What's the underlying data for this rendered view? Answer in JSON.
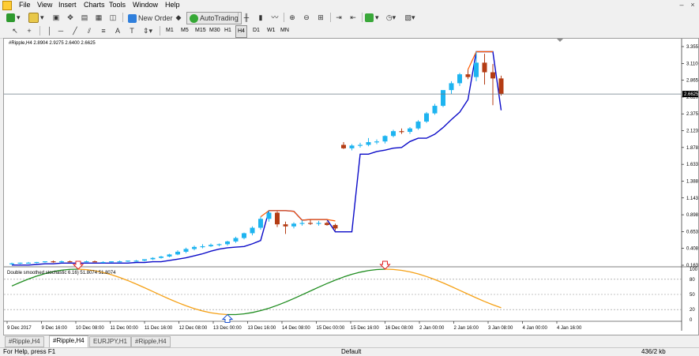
{
  "menu": {
    "items": [
      "File",
      "View",
      "Insert",
      "Charts",
      "Tools",
      "Window",
      "Help"
    ]
  },
  "toolbar": {
    "new_order": "New Order",
    "autotrading": "AutoTrading"
  },
  "timeframes": [
    "M1",
    "M5",
    "M15",
    "M30",
    "H1",
    "H4",
    "D1",
    "W1",
    "MN"
  ],
  "active_timeframe": "H4",
  "chart": {
    "symbol_label": "#Ripple,H4  2.8904 2.9275 2.6400 2.6625",
    "current_price": "2.6625",
    "price_axis": [
      "3.3550",
      "3.1100",
      "2.8650",
      "2.6200",
      "2.3750",
      "2.1230",
      "1.8780",
      "1.6330",
      "1.3880",
      "1.1430",
      "0.8980",
      "0.6530",
      "0.4080",
      "0.1630"
    ],
    "time_axis": [
      "9 Dec 2017",
      "9 Dec 16:00",
      "10 Dec 08:00",
      "11 Dec 00:00",
      "11 Dec 16:00",
      "12 Dec 08:00",
      "13 Dec 00:00",
      "13 Dec 16:00",
      "14 Dec 08:00",
      "15 Dec 00:00",
      "15 Dec 16:00",
      "16 Dec 08:00",
      "2 Jan 00:00",
      "2 Jan 16:00",
      "3 Jan 08:00",
      "4 Jan 00:00",
      "4 Jan 16:00"
    ],
    "indicator_label": "Double smoothed stochastic 6.16) 51.8074 51.8074",
    "indicator_axis": [
      "100",
      "80",
      "50",
      "20",
      "0"
    ],
    "colors": {
      "bull": "#1eb4f0",
      "bear": "#b43c14",
      "trail_up": "#0a0ac8",
      "trail_down": "#ff5a00",
      "stoch_up": "#1e8c1e",
      "stoch_down": "#f5a014",
      "arrow_down": "#e02020",
      "arrow_up": "#1a50d0"
    }
  },
  "chart_data": {
    "type": "candlestick",
    "ylim": [
      0.163,
      3.355
    ],
    "candles": [
      {
        "o": 0.18,
        "h": 0.2,
        "l": 0.17,
        "c": 0.19
      },
      {
        "o": 0.19,
        "h": 0.2,
        "l": 0.18,
        "c": 0.2
      },
      {
        "o": 0.2,
        "h": 0.21,
        "l": 0.19,
        "c": 0.2
      },
      {
        "o": 0.2,
        "h": 0.21,
        "l": 0.19,
        "c": 0.21
      },
      {
        "o": 0.21,
        "h": 0.22,
        "l": 0.2,
        "c": 0.22
      },
      {
        "o": 0.22,
        "h": 0.23,
        "l": 0.2,
        "c": 0.21
      },
      {
        "o": 0.21,
        "h": 0.23,
        "l": 0.2,
        "c": 0.22
      },
      {
        "o": 0.22,
        "h": 0.23,
        "l": 0.21,
        "c": 0.21
      },
      {
        "o": 0.21,
        "h": 0.22,
        "l": 0.2,
        "c": 0.22
      },
      {
        "o": 0.22,
        "h": 0.23,
        "l": 0.21,
        "c": 0.22
      },
      {
        "o": 0.22,
        "h": 0.23,
        "l": 0.21,
        "c": 0.21
      },
      {
        "o": 0.21,
        "h": 0.22,
        "l": 0.2,
        "c": 0.21
      },
      {
        "o": 0.21,
        "h": 0.22,
        "l": 0.2,
        "c": 0.22
      },
      {
        "o": 0.22,
        "h": 0.23,
        "l": 0.21,
        "c": 0.22
      },
      {
        "o": 0.22,
        "h": 0.23,
        "l": 0.21,
        "c": 0.23
      },
      {
        "o": 0.23,
        "h": 0.24,
        "l": 0.22,
        "c": 0.23
      },
      {
        "o": 0.23,
        "h": 0.25,
        "l": 0.22,
        "c": 0.25
      },
      {
        "o": 0.25,
        "h": 0.28,
        "l": 0.24,
        "c": 0.27
      },
      {
        "o": 0.27,
        "h": 0.3,
        "l": 0.26,
        "c": 0.29
      },
      {
        "o": 0.29,
        "h": 0.33,
        "l": 0.28,
        "c": 0.32
      },
      {
        "o": 0.32,
        "h": 0.38,
        "l": 0.31,
        "c": 0.36
      },
      {
        "o": 0.36,
        "h": 0.42,
        "l": 0.34,
        "c": 0.4
      },
      {
        "o": 0.4,
        "h": 0.45,
        "l": 0.38,
        "c": 0.43
      },
      {
        "o": 0.43,
        "h": 0.47,
        "l": 0.41,
        "c": 0.44
      },
      {
        "o": 0.44,
        "h": 0.48,
        "l": 0.43,
        "c": 0.46
      },
      {
        "o": 0.46,
        "h": 0.48,
        "l": 0.44,
        "c": 0.47
      },
      {
        "o": 0.47,
        "h": 0.52,
        "l": 0.45,
        "c": 0.51
      },
      {
        "o": 0.51,
        "h": 0.58,
        "l": 0.49,
        "c": 0.56
      },
      {
        "o": 0.56,
        "h": 0.64,
        "l": 0.54,
        "c": 0.63
      },
      {
        "o": 0.63,
        "h": 0.73,
        "l": 0.6,
        "c": 0.71
      },
      {
        "o": 0.71,
        "h": 0.87,
        "l": 0.68,
        "c": 0.84
      },
      {
        "o": 0.84,
        "h": 0.96,
        "l": 0.8,
        "c": 0.93
      },
      {
        "o": 0.93,
        "h": 0.95,
        "l": 0.72,
        "c": 0.76
      },
      {
        "o": 0.76,
        "h": 0.8,
        "l": 0.62,
        "c": 0.73
      },
      {
        "o": 0.73,
        "h": 0.79,
        "l": 0.7,
        "c": 0.77
      },
      {
        "o": 0.77,
        "h": 0.82,
        "l": 0.74,
        "c": 0.78
      },
      {
        "o": 0.78,
        "h": 0.83,
        "l": 0.75,
        "c": 0.77
      },
      {
        "o": 0.77,
        "h": 0.81,
        "l": 0.74,
        "c": 0.78
      },
      {
        "o": 0.78,
        "h": 0.8,
        "l": 0.74,
        "c": 0.75
      },
      {
        "o": 0.75,
        "h": 0.77,
        "l": 0.67,
        "c": 0.7
      },
      {
        "o": 1.92,
        "h": 1.96,
        "l": 1.86,
        "c": 1.87
      },
      {
        "o": 1.87,
        "h": 1.93,
        "l": 1.84,
        "c": 1.91
      },
      {
        "o": 1.91,
        "h": 1.95,
        "l": 1.88,
        "c": 1.92
      },
      {
        "o": 1.92,
        "h": 2.02,
        "l": 1.9,
        "c": 1.96
      },
      {
        "o": 1.96,
        "h": 2.0,
        "l": 1.93,
        "c": 1.97
      },
      {
        "o": 1.97,
        "h": 2.06,
        "l": 1.94,
        "c": 2.05
      },
      {
        "o": 2.05,
        "h": 2.14,
        "l": 2.03,
        "c": 2.12
      },
      {
        "o": 2.12,
        "h": 2.16,
        "l": 2.08,
        "c": 2.11
      },
      {
        "o": 2.11,
        "h": 2.18,
        "l": 2.08,
        "c": 2.16
      },
      {
        "o": 2.16,
        "h": 2.28,
        "l": 2.14,
        "c": 2.26
      },
      {
        "o": 2.26,
        "h": 2.4,
        "l": 2.24,
        "c": 2.38
      },
      {
        "o": 2.38,
        "h": 2.52,
        "l": 2.36,
        "c": 2.49
      },
      {
        "o": 2.49,
        "h": 2.7,
        "l": 2.47,
        "c": 2.72
      },
      {
        "o": 2.72,
        "h": 2.85,
        "l": 2.66,
        "c": 2.82
      },
      {
        "o": 2.82,
        "h": 2.97,
        "l": 2.78,
        "c": 2.95
      },
      {
        "o": 2.95,
        "h": 3.02,
        "l": 2.88,
        "c": 2.91
      },
      {
        "o": 2.91,
        "h": 3.28,
        "l": 2.85,
        "c": 3.12
      },
      {
        "o": 3.12,
        "h": 3.25,
        "l": 2.8,
        "c": 2.98
      },
      {
        "o": 2.98,
        "h": 3.1,
        "l": 2.5,
        "c": 2.89
      },
      {
        "o": 2.89,
        "h": 2.93,
        "l": 2.64,
        "c": 2.66
      }
    ],
    "stochastic": {
      "ylim": [
        0,
        100
      ],
      "levels": [
        80,
        50,
        20
      ]
    }
  }
}
